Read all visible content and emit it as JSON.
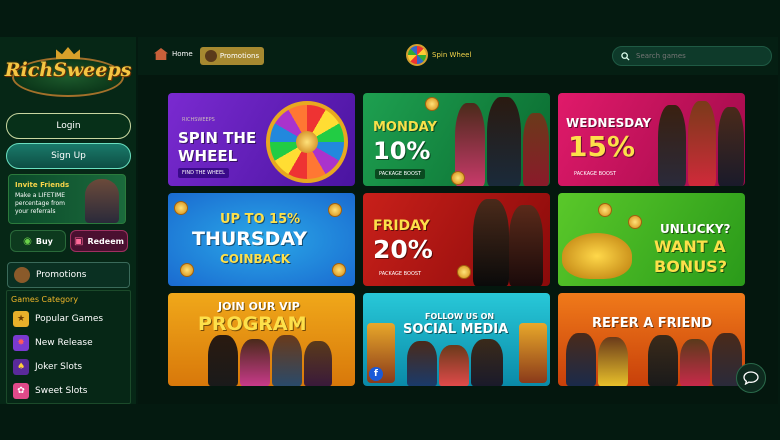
{
  "brand": {
    "logo_text": "RichSweeps"
  },
  "sidebar": {
    "login_label": "Login",
    "signup_label": "Sign Up",
    "invite": {
      "title": "Invite Friends",
      "subtitle": "Make a LIFETIME percentage from your referrals"
    },
    "buy_label": "Buy",
    "redeem_label": "Redeem",
    "promotions_label": "Promotions",
    "category_title": "Games Category",
    "categories": [
      {
        "label": "Popular Games",
        "icon": "shield-star-icon"
      },
      {
        "label": "New Release",
        "icon": "new-badge-icon"
      },
      {
        "label": "Joker Slots",
        "icon": "joker-icon"
      },
      {
        "label": "Sweet Slots",
        "icon": "candy-icon"
      }
    ]
  },
  "topbar": {
    "home_label": "Home",
    "promotions_label": "Promotions",
    "spin_wheel_label": "Spin Wheel",
    "search_placeholder": "Search games"
  },
  "promotions": [
    {
      "line1": "SPIN THE",
      "line2": "WHEEL",
      "pill": "FIND THE WHEEL",
      "tag": "RICHSWEEPS"
    },
    {
      "line1": "MONDAY",
      "line2": "10%",
      "pill": "PACKAGE BOOST"
    },
    {
      "line1": "WEDNESDAY",
      "line2": "15%",
      "pill": "PACKAGE BOOST"
    },
    {
      "line1": "UP TO 15%",
      "line2": "THURSDAY",
      "line3": "COINBACK"
    },
    {
      "line1": "FRIDAY",
      "line2": "20%",
      "pill": "PACKAGE BOOST"
    },
    {
      "line1": "UNLUCKY?",
      "line2": "WANT A",
      "line3": "BONUS?"
    },
    {
      "line1": "JOIN OUR VIP",
      "line2": "PROGRAM"
    },
    {
      "line1": "FOLLOW US ON",
      "line2": "SOCIAL MEDIA"
    },
    {
      "line1": "REFER A FRIEND"
    }
  ],
  "colors": {
    "accent_gold": "#f4c643",
    "sidebar_bg": "#062716",
    "page_bg": "#04170e"
  }
}
